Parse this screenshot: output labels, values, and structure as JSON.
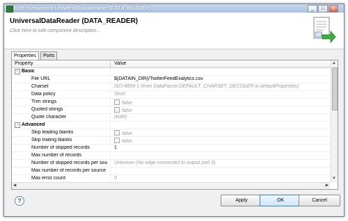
{
  "window": {
    "title": "Edit component UniversalDataReader (DATA_READER)",
    "controls": {
      "minimize": "_",
      "maximize": "□",
      "close": "X"
    }
  },
  "header": {
    "component_title": "UniversalDataReader (DATA_READER)",
    "description_placeholder": "Click here to edit component description...",
    "icon": "reader-component-icon"
  },
  "tabs": [
    {
      "label": "Properties",
      "active": true
    },
    {
      "label": "Ports",
      "active": false
    }
  ],
  "table": {
    "columns": {
      "property": "Property",
      "value": "Value"
    },
    "groups": [
      {
        "label": "Basic",
        "toggle": "−",
        "rows": [
          {
            "name": "File URL",
            "value": "${DATAIN_DIR}/TwitterFeedExalytics.csv",
            "style": "normal"
          },
          {
            "name": "Charset",
            "value": "ISO-8859-1 (from DataParser.DEFAULT_CHARSET_DECODER in defaultProperties)",
            "style": "dim"
          },
          {
            "name": "Data policy",
            "value": "Strict",
            "style": "dim"
          },
          {
            "name": "Trim strings",
            "value": "false",
            "style": "check"
          },
          {
            "name": "Quoted strings",
            "value": "false",
            "style": "check"
          },
          {
            "name": "Quote character",
            "value": "(both)",
            "style": "dim"
          }
        ]
      },
      {
        "label": "Advanced",
        "toggle": "−",
        "rows": [
          {
            "name": "Skip leading blanks",
            "value": "false",
            "style": "check"
          },
          {
            "name": "Skip trailing blanks",
            "value": "false",
            "style": "check"
          },
          {
            "name": "Number of skipped records",
            "value": "1",
            "style": "normal"
          },
          {
            "name": "Max number of records",
            "value": "",
            "style": "normal"
          },
          {
            "name": "Number of skipped records per sou",
            "value": "Unknown (No edge connected to output port 0)",
            "style": "dim"
          },
          {
            "name": "Max number of records per source",
            "value": "",
            "style": "normal"
          },
          {
            "name": "Max error count",
            "value": "0",
            "style": "dim"
          }
        ]
      }
    ]
  },
  "buttons": {
    "apply": "Apply",
    "ok": "OK",
    "cancel": "Cancel",
    "help": "?"
  },
  "colors": {
    "accent": "#3c7fb1",
    "titlebar": "#a9c2e2"
  }
}
